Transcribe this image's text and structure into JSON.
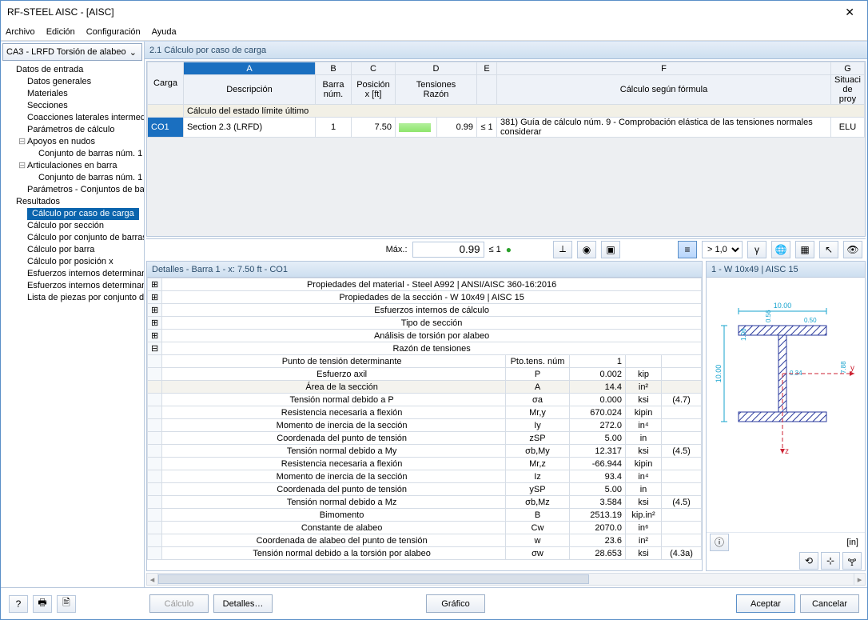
{
  "window_title": "RF-STEEL AISC - [AISC]",
  "menu": [
    "Archivo",
    "Edición",
    "Configuración",
    "Ayuda"
  ],
  "case_selector": "CA3 - LRFD Torsión de alabeo",
  "tree": [
    {
      "lvl": 1,
      "toggler": "",
      "label": "Datos de entrada"
    },
    {
      "lvl": 2,
      "toggler": "",
      "label": "Datos generales"
    },
    {
      "lvl": 2,
      "toggler": "",
      "label": "Materiales"
    },
    {
      "lvl": 2,
      "toggler": "",
      "label": "Secciones"
    },
    {
      "lvl": 2,
      "toggler": "",
      "label": "Coacciones laterales intermedias"
    },
    {
      "lvl": 2,
      "toggler": "",
      "label": "Parámetros de cálculo"
    },
    {
      "lvl": 2,
      "toggler": "⊟",
      "label": "Apoyos en nudos"
    },
    {
      "lvl": 3,
      "toggler": "",
      "label": "Conjunto de barras núm. 1"
    },
    {
      "lvl": 2,
      "toggler": "⊟",
      "label": "Articulaciones en barra"
    },
    {
      "lvl": 3,
      "toggler": "",
      "label": "Conjunto de barras núm. 1"
    },
    {
      "lvl": 2,
      "toggler": "",
      "label": "Parámetros - Conjuntos de barras"
    },
    {
      "lvl": 1,
      "toggler": "",
      "label": "Resultados"
    },
    {
      "lvl": 2,
      "toggler": "",
      "label": "Cálculo por caso de carga",
      "sel": true
    },
    {
      "lvl": 2,
      "toggler": "",
      "label": "Cálculo por sección"
    },
    {
      "lvl": 2,
      "toggler": "",
      "label": "Cálculo por conjunto de barras"
    },
    {
      "lvl": 2,
      "toggler": "",
      "label": "Cálculo por barra"
    },
    {
      "lvl": 2,
      "toggler": "",
      "label": "Cálculo por posición x"
    },
    {
      "lvl": 2,
      "toggler": "",
      "label": "Esfuerzos internos determinantes"
    },
    {
      "lvl": 2,
      "toggler": "",
      "label": "Esfuerzos internos determinantes"
    },
    {
      "lvl": 2,
      "toggler": "",
      "label": "Lista de piezas por conjunto de barras"
    }
  ],
  "section_title": "2.1 Cálculo por caso de carga",
  "cols": {
    "letters": [
      "A",
      "B",
      "C",
      "D",
      "E",
      "F",
      "G"
    ],
    "load": "Carga",
    "desc": "Descripción",
    "barnum_top": "Barra",
    "barnum": "núm.",
    "pos_top": "Posición",
    "pos": "x [ft]",
    "ratio_top": "Tensiones",
    "ratio": "Razón",
    "formula": "Cálculo según fórmula",
    "sit_top": "Situaci",
    "sit": "de proy"
  },
  "group_row": "Cálculo del estado límite último",
  "data_row": {
    "load": "CO1",
    "desc": "Section 2.3 (LRFD)",
    "bar": "1",
    "pos": "7.50",
    "ratio": "0.99",
    "cmp": "≤ 1",
    "formula": "381) Guía de cálculo núm. 9 - Comprobación elástica de las tensiones normales considerar",
    "sit": "ELU"
  },
  "max_label": "Máx.:",
  "max_val": "0.99",
  "max_cmp": "≤ 1",
  "scale_sel": "> 1,0",
  "details_title": "Detalles - Barra 1 - x: 7.50 ft - CO1",
  "detail_groups": [
    {
      "exp": "⊞",
      "label": "Propiedades del material - Steel A992 | ANSI/AISC 360-16:2016"
    },
    {
      "exp": "⊞",
      "label": "Propiedades de la sección  -  W 10x49 | AISC 15"
    },
    {
      "exp": "⊞",
      "label": "Esfuerzos internos de cálculo"
    },
    {
      "exp": "⊞",
      "label": "Tipo de sección"
    },
    {
      "exp": "⊞",
      "label": "Análisis de torsión por alabeo"
    },
    {
      "exp": "⊟",
      "label": "Razón de tensiones"
    }
  ],
  "detail_rows": [
    {
      "d": "Punto de tensión determinante",
      "s": "Pto.tens. núm",
      "v": "1",
      "u": "",
      "r": ""
    },
    {
      "d": "Esfuerzo axil",
      "s": "P",
      "v": "0.002",
      "u": "kip",
      "r": ""
    },
    {
      "d": "Área de la sección",
      "s": "A",
      "v": "14.4",
      "u": "in²",
      "r": "",
      "grey": true
    },
    {
      "d": "Tensión normal debido a P",
      "s": "σa",
      "v": "0.000",
      "u": "ksi",
      "r": "(4.7)"
    },
    {
      "d": "Resistencia necesaria a flexión",
      "s": "Mr,y",
      "v": "670.024",
      "u": "kipin",
      "r": ""
    },
    {
      "d": "Momento de inercia de la sección",
      "s": "Iy",
      "v": "272.0",
      "u": "in⁴",
      "r": ""
    },
    {
      "d": "Coordenada del punto de tensión",
      "s": "zSP",
      "v": "5.00",
      "u": "in",
      "r": ""
    },
    {
      "d": "Tensión normal debido a My",
      "s": "σb,My",
      "v": "12.317",
      "u": "ksi",
      "r": "(4.5)"
    },
    {
      "d": "Resistencia necesaria a flexión",
      "s": "Mr,z",
      "v": "-66.944",
      "u": "kipin",
      "r": ""
    },
    {
      "d": "Momento de inercia de la sección",
      "s": "Iz",
      "v": "93.4",
      "u": "in⁴",
      "r": ""
    },
    {
      "d": "Coordenada del punto de tensión",
      "s": "ySP",
      "v": "5.00",
      "u": "in",
      "r": ""
    },
    {
      "d": "Tensión normal debido a Mz",
      "s": "σb,Mz",
      "v": "3.584",
      "u": "ksi",
      "r": "(4.5)"
    },
    {
      "d": "Bimomento",
      "s": "B",
      "v": "2513.19",
      "u": "kip.in²",
      "r": ""
    },
    {
      "d": "Constante de alabeo",
      "s": "Cw",
      "v": "2070.0",
      "u": "in⁶",
      "r": ""
    },
    {
      "d": "Coordenada de alabeo del punto de tensión",
      "s": "w",
      "v": "23.6",
      "u": "in²",
      "r": ""
    },
    {
      "d": "Tensión normal debido a la torsión por alabeo",
      "s": "σw",
      "v": "28.653",
      "u": "ksi",
      "r": "(4.3a)"
    }
  ],
  "preview_title": "1 - W 10x49 | AISC 15",
  "preview_unit": "[in]",
  "dims": {
    "bf": "10.00",
    "d": "10.00",
    "tf": "0.56",
    "tw": "0.34",
    "k": "1.06",
    "half_bf": "0.50",
    "bf_tw": "7.88"
  },
  "footer": {
    "calc": "Cálculo",
    "details": "Detalles…",
    "graph": "Gráfico",
    "ok": "Aceptar",
    "cancel": "Cancelar"
  }
}
